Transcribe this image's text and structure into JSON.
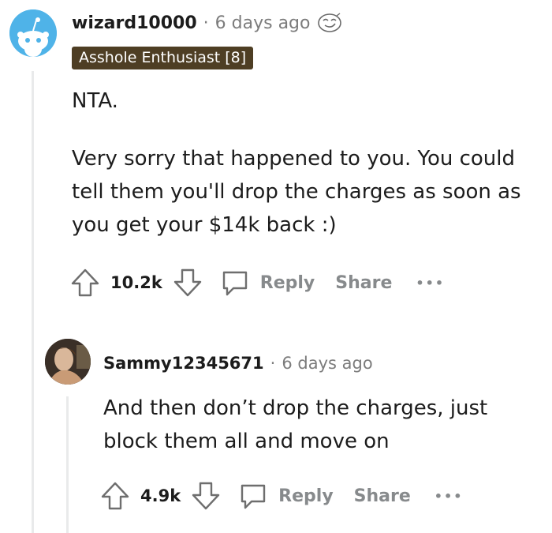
{
  "comment": {
    "username": "wizard10000",
    "timestamp": "6 days ago",
    "award_icon": "smirk-face-icon",
    "flair": "Asshole Enthusiast [8]",
    "body_line1": "NTA.",
    "body_line2": "Very sorry that happened to you. You could tell them you'll drop the charges as soon as you get your $14k back :)",
    "score": "10.2k",
    "reply_label": "Reply",
    "share_label": "Share",
    "more_label": "•••"
  },
  "reply": {
    "username": "Sammy12345671",
    "timestamp": "6 days ago",
    "body": "And then don’t drop the charges, just block them all and move on",
    "score": "4.9k",
    "reply_label": "Reply",
    "share_label": "Share",
    "more_label": "•••"
  },
  "separator": "·",
  "colors": {
    "flair_bg": "#4e3e24",
    "avatar_blue": "#4fb3e8",
    "muted_text": "#7c7c7c",
    "thread_line": "#e9eaeb"
  }
}
